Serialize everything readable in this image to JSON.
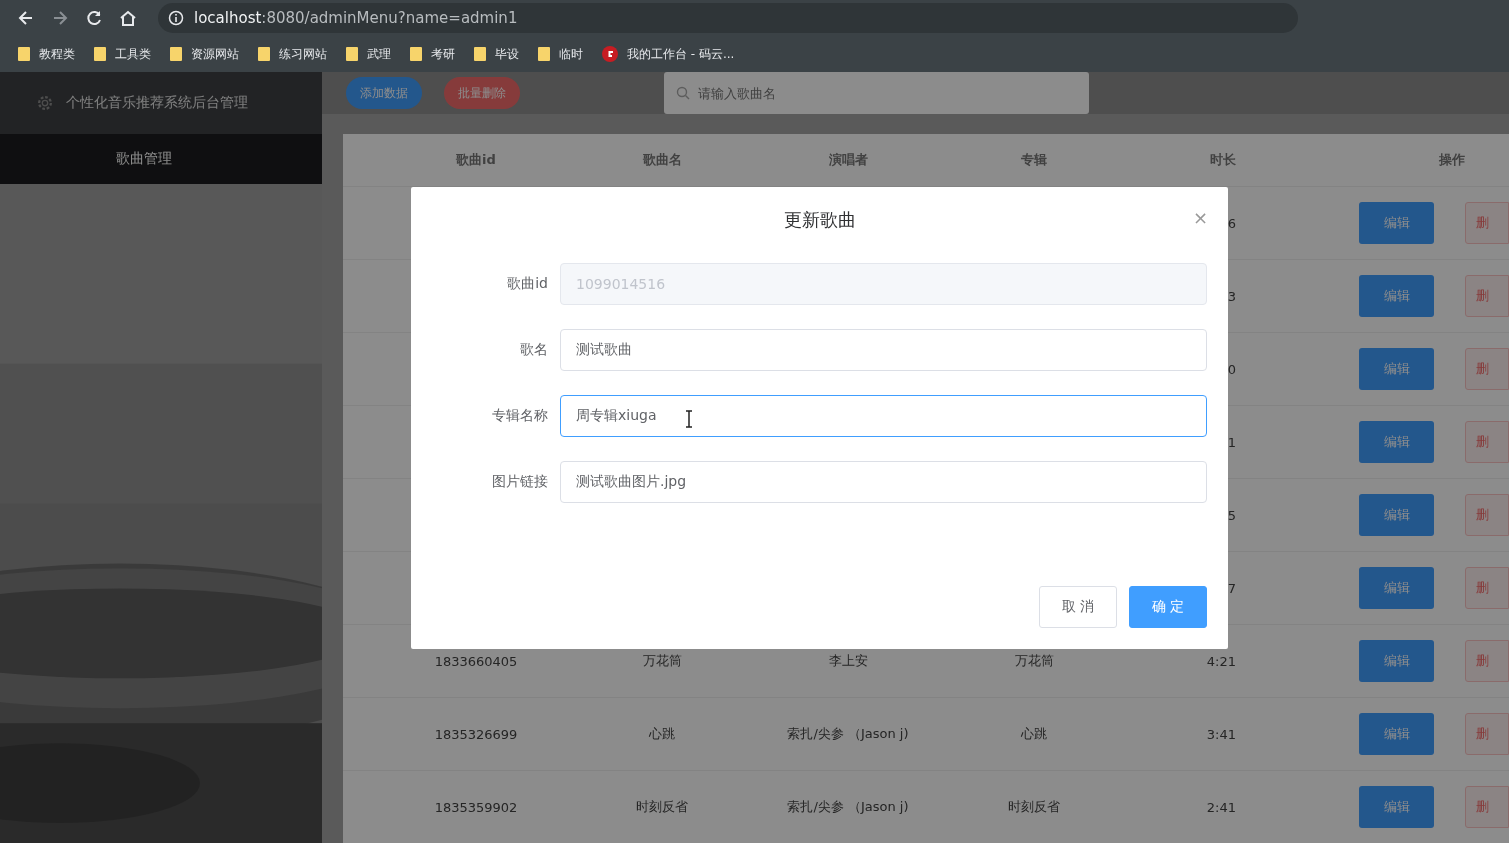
{
  "browser": {
    "url_host": "localhost",
    "url_rest": ":8080/adminMenu?name=admin1",
    "forward_disabled": true,
    "bookmarks": [
      {
        "kind": "folder",
        "label": "教程类"
      },
      {
        "kind": "folder",
        "label": "工具类"
      },
      {
        "kind": "folder",
        "label": "资源网站"
      },
      {
        "kind": "folder",
        "label": "练习网站"
      },
      {
        "kind": "folder",
        "label": "武理"
      },
      {
        "kind": "folder",
        "label": "考研"
      },
      {
        "kind": "folder",
        "label": "毕设"
      },
      {
        "kind": "folder",
        "label": "临时"
      },
      {
        "kind": "site",
        "label": "我的工作台 - 码云..."
      }
    ]
  },
  "sidebar": {
    "title": "个性化音乐推荐系统后台管理",
    "items": [
      {
        "label": "歌曲管理",
        "selected": true
      }
    ]
  },
  "toolbar": {
    "buttons": [
      {
        "kind": "primary",
        "label": "添加数据"
      },
      {
        "kind": "danger",
        "label": "批量删除"
      }
    ],
    "search": {
      "placeholder": "请输入歌曲名"
    }
  },
  "table": {
    "columns": [
      "歌曲id",
      "歌曲名",
      "演唱者",
      "专辑",
      "时长",
      "操作"
    ],
    "rows": [
      {
        "duration": "6",
        "edit": "编辑",
        "delete": "删"
      },
      {
        "duration": "3",
        "edit": "编辑",
        "delete": "删"
      },
      {
        "duration": "0",
        "edit": "编辑",
        "delete": "删"
      },
      {
        "duration": "1",
        "edit": "编辑",
        "delete": "删"
      },
      {
        "duration": "5",
        "edit": "编辑",
        "delete": "删"
      },
      {
        "duration": "7",
        "edit": "编辑",
        "delete": "删"
      },
      {
        "id": "1833660405",
        "name": "万花筒",
        "artist": "李上安",
        "album": "万花筒",
        "duration": "4:21",
        "edit": "编辑",
        "delete": "删"
      },
      {
        "id": "1835326699",
        "name": "心跳",
        "artist": "索扎/尖参 （Jason j)",
        "album": "心跳",
        "duration": "3:41",
        "edit": "编辑",
        "delete": "删"
      },
      {
        "id": "1835359902",
        "name": "时刻反省",
        "artist": "索扎/尖参 （Jason j)",
        "album": "时刻反省",
        "duration": "2:41",
        "edit": "编辑",
        "delete": "删"
      }
    ]
  },
  "dialog": {
    "title": "更新歌曲",
    "close": "×",
    "fields": [
      {
        "label": "歌曲id",
        "value": "1099014516",
        "disabled": true,
        "focused": false
      },
      {
        "label": "歌名",
        "value": "测试歌曲",
        "disabled": false,
        "focused": false
      },
      {
        "label": "专辑名称",
        "value": "周专辑xiuga",
        "disabled": false,
        "focused": true
      },
      {
        "label": "图片链接",
        "value": "测试歌曲图片.jpg",
        "disabled": false,
        "focused": false
      }
    ],
    "buttons": [
      {
        "kind": "default",
        "label": "取 消"
      },
      {
        "kind": "primary",
        "label": "确 定"
      }
    ]
  }
}
